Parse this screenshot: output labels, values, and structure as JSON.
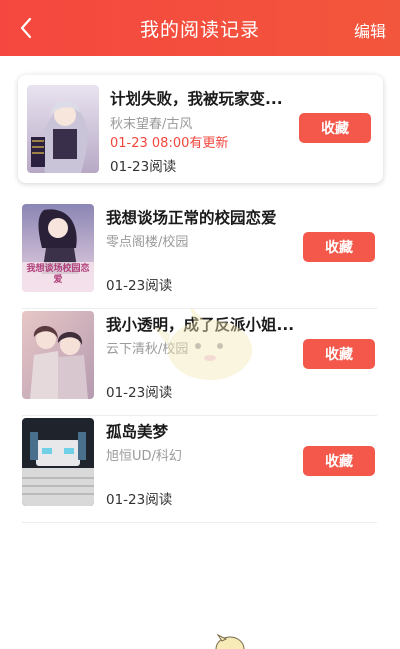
{
  "header": {
    "title": "我的阅读记录",
    "edit_label": "编辑",
    "background": "#f5473f",
    "back_icon": "chevron-left-icon"
  },
  "books": [
    {
      "title": "计划失败，我被玩家变...",
      "author_genre": "秋末望春/古风",
      "update": "01-23 08:00有更新",
      "read": "01-23阅读",
      "button": "收藏",
      "cover_text": ""
    },
    {
      "title": "我想谈场正常的校园恋爱",
      "author_genre": "零点阁楼/校园",
      "read": "01-23阅读",
      "button": "收藏",
      "cover_text": "我想谈场校园恋爱"
    },
    {
      "title": "我小透明，成了反派小姐...",
      "author_genre": "云下清秋/校园",
      "read": "01-23阅读",
      "button": "收藏",
      "cover_text": ""
    },
    {
      "title": "孤岛美梦",
      "author_genre": "旭恒UD/科幻",
      "read": "01-23阅读",
      "button": "收藏",
      "cover_text": ""
    }
  ],
  "colors": {
    "accent": "#f4584a",
    "update_text": "#f0473c"
  }
}
